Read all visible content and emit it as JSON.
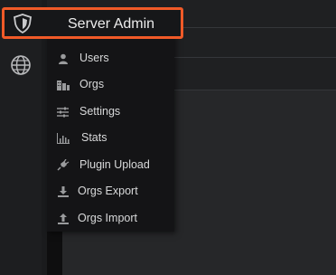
{
  "header": {
    "title": "Server Admin"
  },
  "menu": {
    "items": [
      {
        "label": "Users",
        "icon": "user-icon"
      },
      {
        "label": "Orgs",
        "icon": "orgs-icon"
      },
      {
        "label": "Settings",
        "icon": "sliders-icon"
      },
      {
        "label": "Stats",
        "icon": "bar-chart-icon"
      },
      {
        "label": "Plugin Upload",
        "icon": "plug-icon"
      },
      {
        "label": "Orgs Export",
        "icon": "download-icon"
      },
      {
        "label": "Orgs Import",
        "icon": "upload-icon"
      }
    ]
  },
  "sidebar": {
    "icons": [
      "shield-icon",
      "globe-icon"
    ]
  },
  "colors": {
    "highlight": "#f05a28",
    "menu_bg": "#141416",
    "text": "#d8d9da"
  }
}
